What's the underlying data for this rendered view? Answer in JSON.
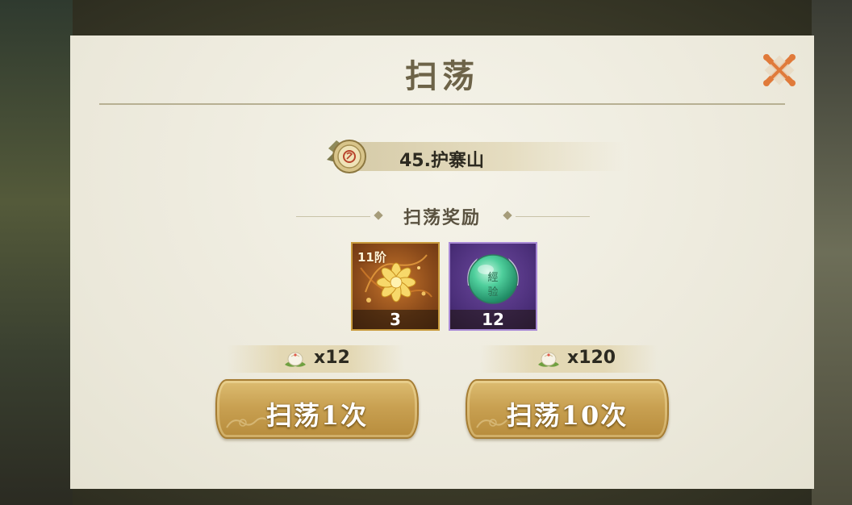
{
  "dialog": {
    "title": "扫荡"
  },
  "stage": {
    "name": "45.护寨山"
  },
  "rewards_section": {
    "title": "扫荡奖励",
    "items": [
      {
        "tier_label": "11阶",
        "count": "3",
        "icon": "golden-lotus-icon",
        "frame_color": "#c89a3c"
      },
      {
        "count": "12",
        "icon": "experience-orb-icon",
        "frame_color": "#a98ad6",
        "orb_text_top": "經",
        "orb_text_bottom": "验"
      }
    ]
  },
  "sweep_options": [
    {
      "cost_icon": "stamina-bun-icon",
      "cost": "x12",
      "button_label": "扫荡1次"
    },
    {
      "cost_icon": "stamina-bun-icon",
      "cost": "x120",
      "button_label": "扫荡10次"
    }
  ],
  "colors": {
    "panel_bg": "#efede2",
    "title": "#6d6348",
    "button_gold": "#c9a152",
    "close_orange": "#e07a3a"
  }
}
